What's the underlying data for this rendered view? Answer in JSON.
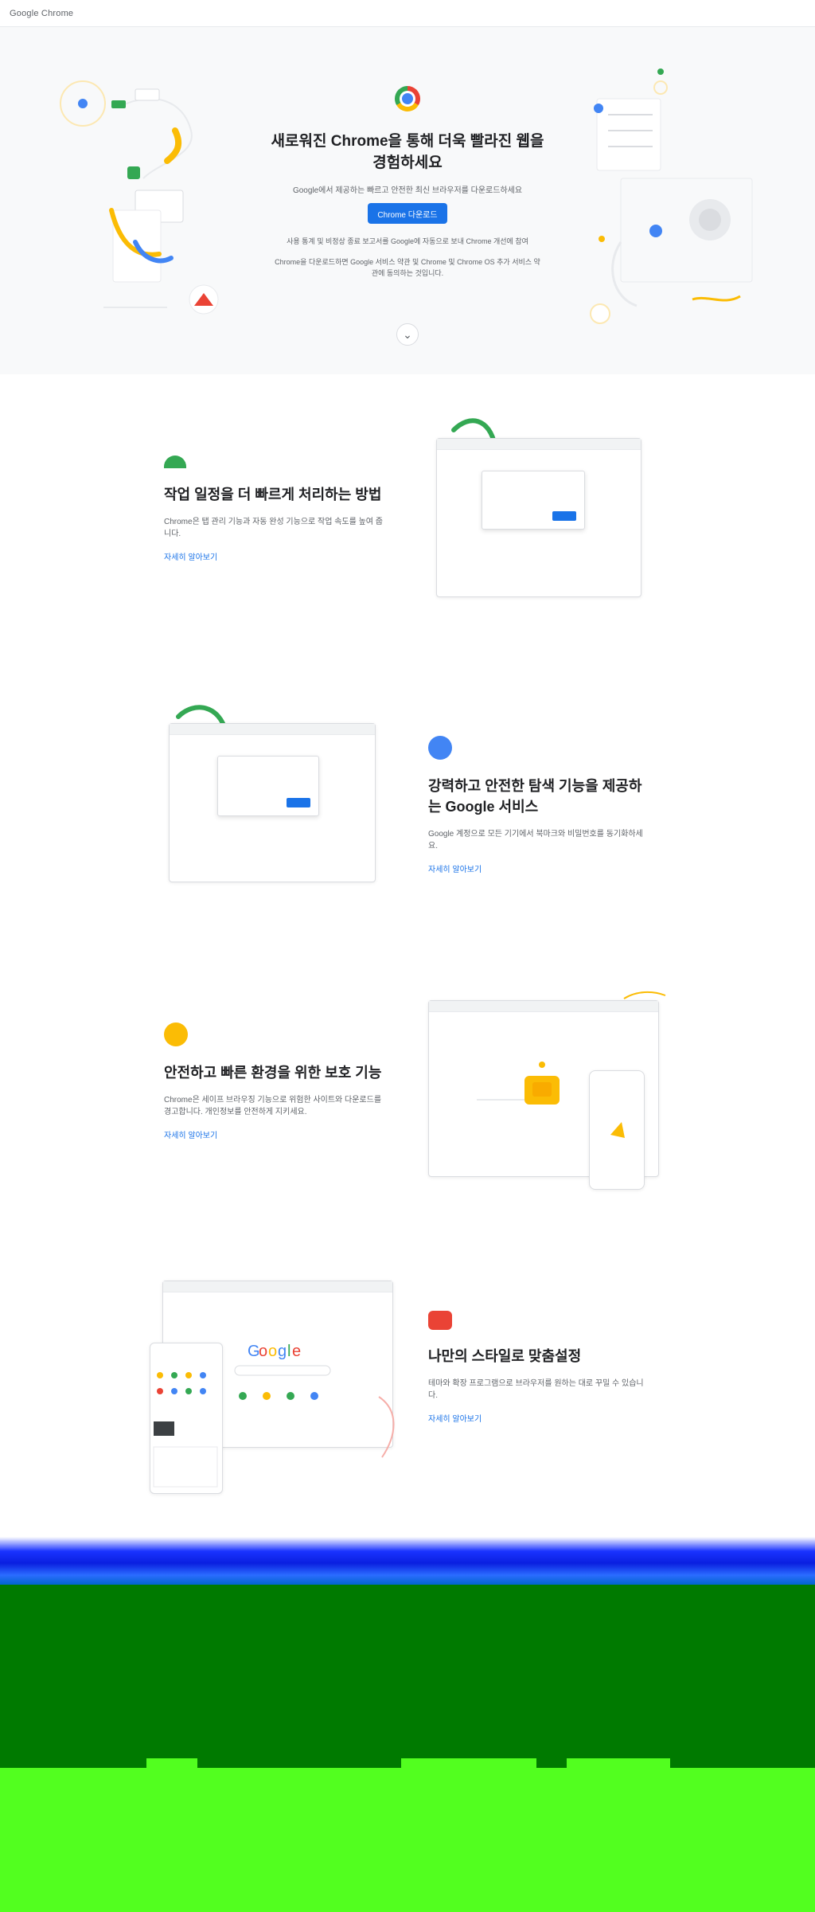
{
  "header": {
    "logo_text": "Google Chrome"
  },
  "hero": {
    "title": "새로워진 Chrome을 통해 더욱 빨라진 웹을 경험하세요",
    "subtitle": "Google에서 제공하는 빠르고 안전한 최신 브라우저를 다운로드하세요",
    "download_button": "Chrome 다운로드",
    "checkbox_text": "사용 통계 및 비정상 종료 보고서를 Google에 자동으로 보내 Chrome 개선에 참여",
    "terms_text": "Chrome을 다운로드하면 Google 서비스 약관 및 Chrome 및 Chrome OS 추가 서비스 약관에 동의하는 것입니다.",
    "scroll_icon": "chevron-down-icon"
  },
  "features": [
    {
      "icon": "speed-icon",
      "title": "작업 일정을 더 빠르게 처리하는 방법",
      "desc": "Chrome은 탭 관리 기능과 자동 완성 기능으로 작업 속도를 높여 줍니다.",
      "link": "자세히 알아보기"
    },
    {
      "icon": "google-icon",
      "title": "강력하고 안전한 탐색 기능을 제공하는 Google 서비스",
      "desc": "Google 계정으로 모든 기기에서 북마크와 비밀번호를 동기화하세요.",
      "link": "자세히 알아보기"
    },
    {
      "icon": "shield-icon",
      "title": "안전하고 빠른 환경을 위한 보호 기능",
      "desc": "Chrome은 세이프 브라우징 기능으로 위험한 사이트와 다운로드를 경고합니다. 개인정보를 안전하게 지키세요.",
      "link": "자세히 알아보기"
    },
    {
      "icon": "extension-icon",
      "title": "나만의 스타일로 맞춤설정",
      "desc": "테마와 확장 프로그램으로 브라우저를 원하는 대로 꾸밀 수 있습니다.",
      "link": "자세히 알아보기"
    }
  ],
  "colors": {
    "accent": "#1a73e8",
    "hero_bg": "#f8f9fa",
    "footer_green": "#007a00",
    "footer_lime": "#52ff1f"
  }
}
